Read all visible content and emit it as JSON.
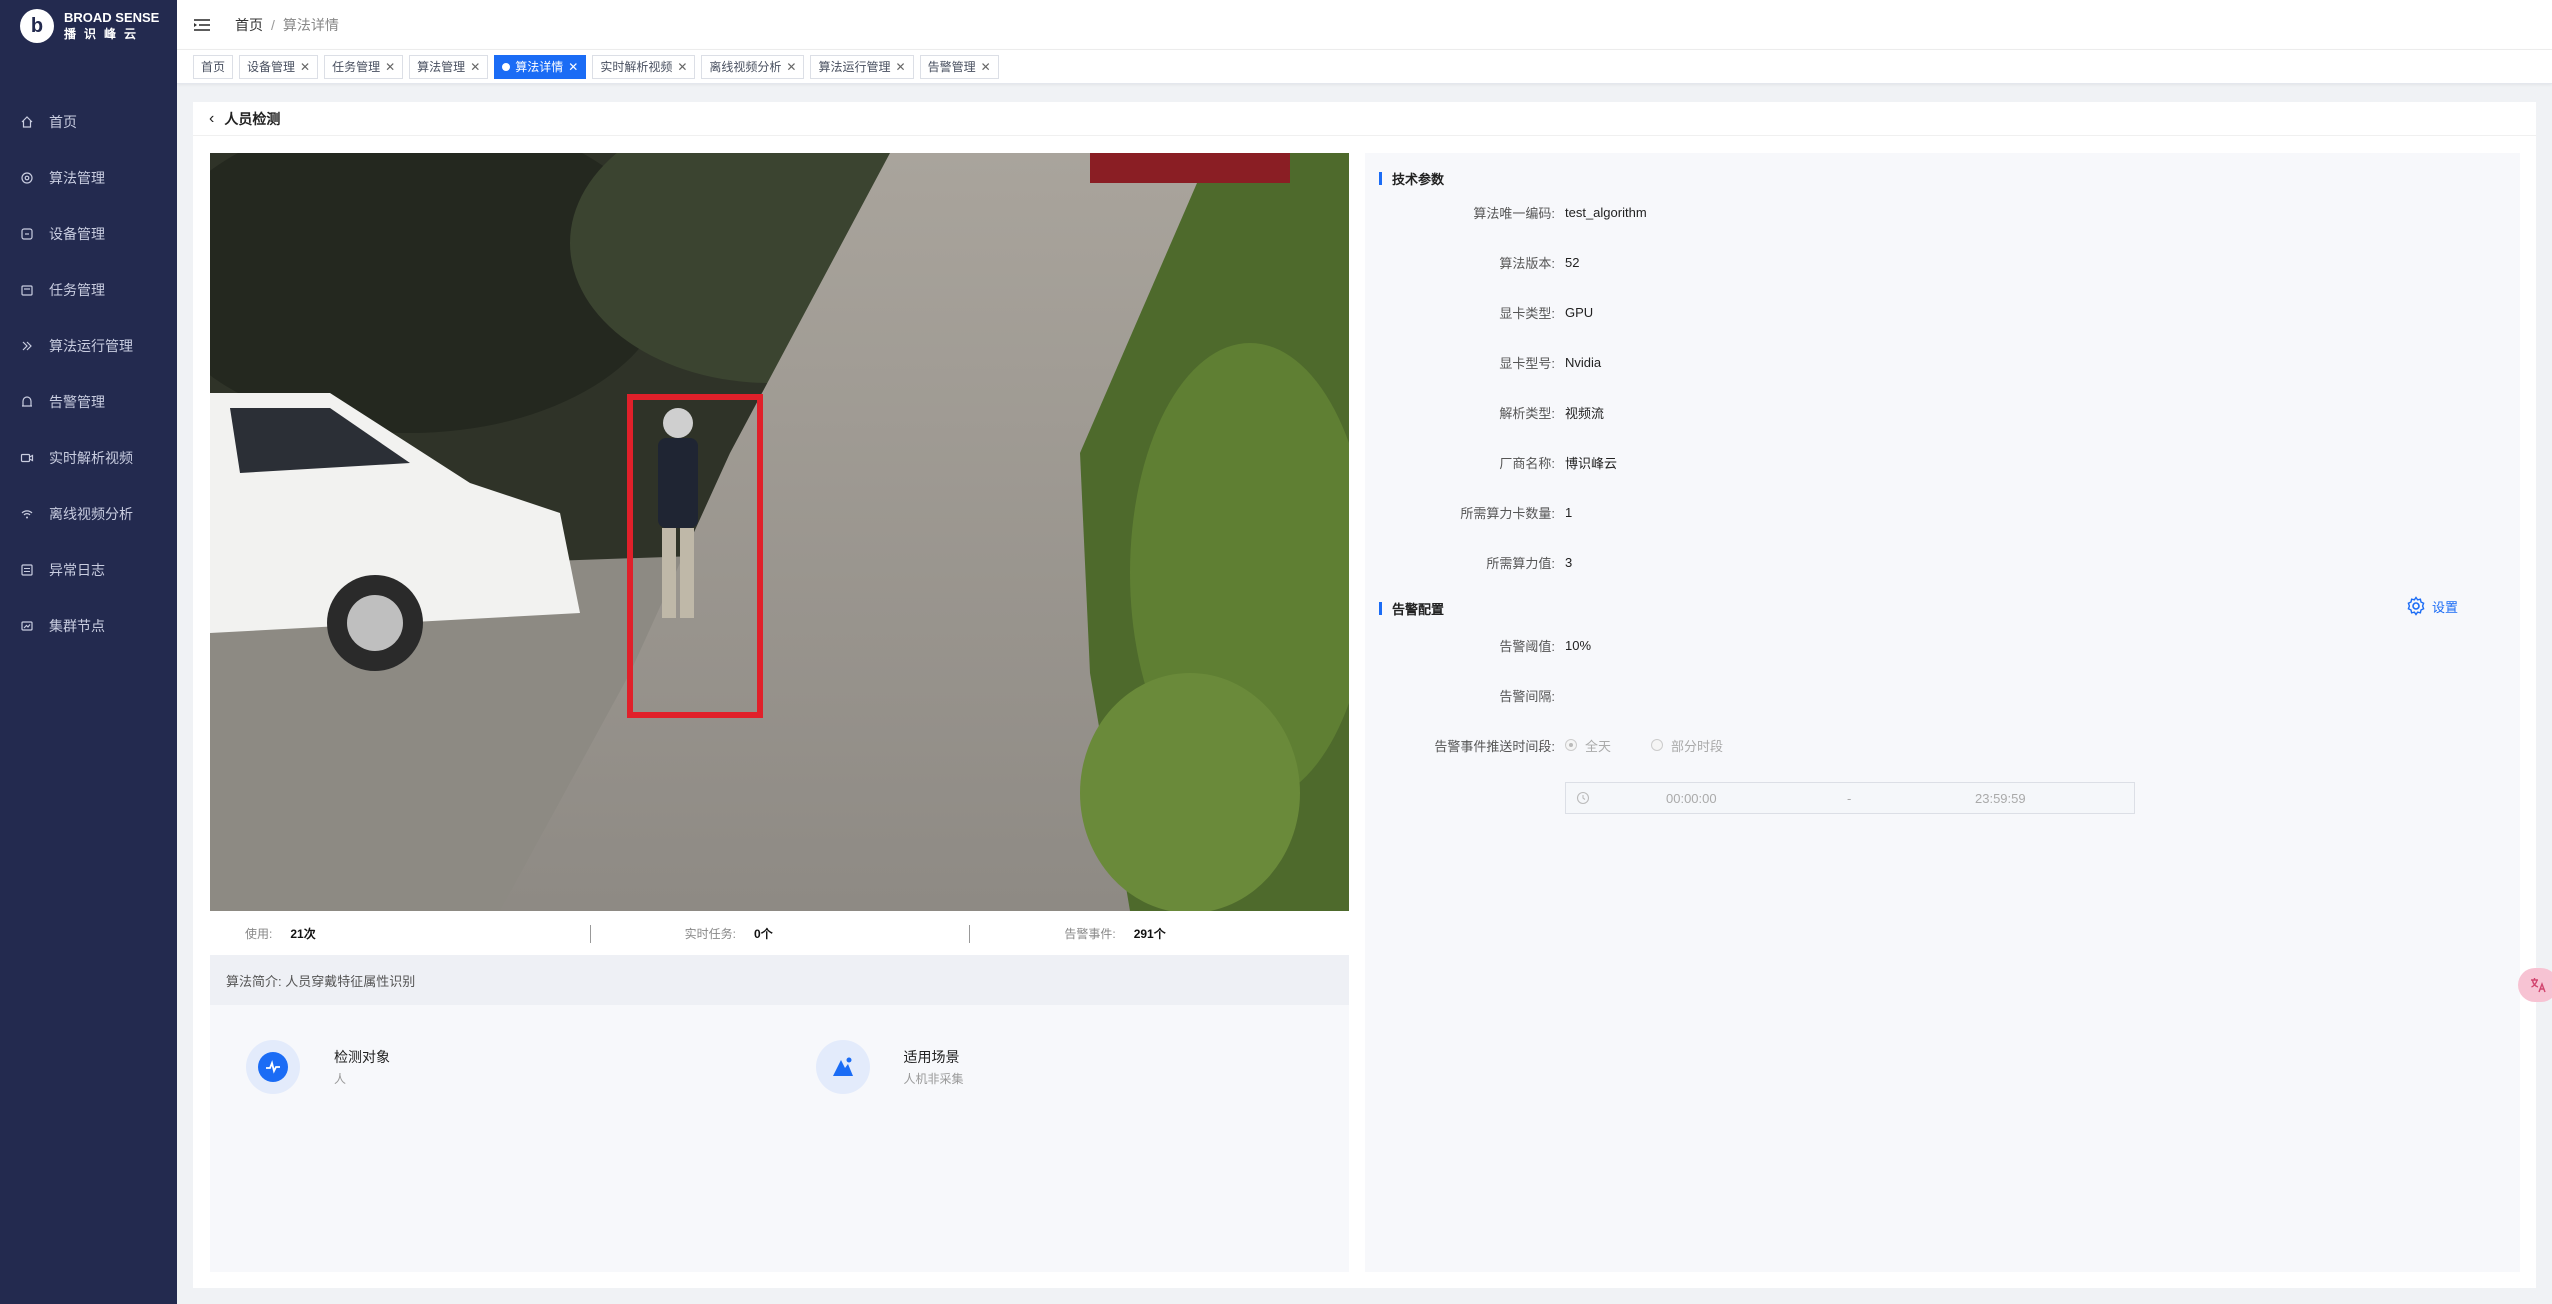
{
  "brand": {
    "logo_letter": "b",
    "name_en": "BROAD SENSE",
    "name_cn": "播识峰云"
  },
  "sidebar": {
    "items": [
      {
        "label": "首页",
        "icon": "home-icon"
      },
      {
        "label": "算法管理",
        "icon": "algorithm-icon"
      },
      {
        "label": "设备管理",
        "icon": "device-icon"
      },
      {
        "label": "任务管理",
        "icon": "task-icon"
      },
      {
        "label": "算法运行管理",
        "icon": "run-icon"
      },
      {
        "label": "告警管理",
        "icon": "alarm-icon"
      },
      {
        "label": "实时解析视频",
        "icon": "video-icon"
      },
      {
        "label": "离线视频分析",
        "icon": "offline-icon"
      },
      {
        "label": "异常日志",
        "icon": "log-icon"
      },
      {
        "label": "集群节点",
        "icon": "cluster-icon"
      }
    ]
  },
  "header": {
    "breadcrumb_home": "首页",
    "breadcrumb_sep": "/",
    "breadcrumb_current": "算法详情"
  },
  "tabs": [
    {
      "label": "首页",
      "closable": false,
      "active": false
    },
    {
      "label": "设备管理",
      "closable": true,
      "active": false
    },
    {
      "label": "任务管理",
      "closable": true,
      "active": false
    },
    {
      "label": "算法管理",
      "closable": true,
      "active": false
    },
    {
      "label": "算法详情",
      "closable": true,
      "active": true
    },
    {
      "label": "实时解析视频",
      "closable": true,
      "active": false
    },
    {
      "label": "离线视频分析",
      "closable": true,
      "active": false
    },
    {
      "label": "算法运行管理",
      "closable": true,
      "active": false
    },
    {
      "label": "告警管理",
      "closable": true,
      "active": false
    }
  ],
  "page": {
    "title": "人员检测"
  },
  "stats": [
    {
      "label": "使用:",
      "value": "21次"
    },
    {
      "label": "实时任务:",
      "value": "0个"
    },
    {
      "label": "告警事件:",
      "value": "291个"
    }
  ],
  "intro": {
    "text": "算法简介: 人员穿戴特征属性识别"
  },
  "features": [
    {
      "title": "检测对象",
      "sub": "人"
    },
    {
      "title": "适用场景",
      "sub": "人机非采集"
    }
  ],
  "tech": {
    "title": "技术参数",
    "rows": [
      {
        "label": "算法唯一编码:",
        "value": "test_algorithm"
      },
      {
        "label": "算法版本:",
        "value": "52"
      },
      {
        "label": "显卡类型:",
        "value": "GPU"
      },
      {
        "label": "显卡型号:",
        "value": "Nvidia"
      },
      {
        "label": "解析类型:",
        "value": "视频流"
      },
      {
        "label": "厂商名称:",
        "value": "博识峰云"
      },
      {
        "label": "所需算力卡数量:",
        "value": "1"
      },
      {
        "label": "所需算力值:",
        "value": "3"
      }
    ]
  },
  "alarm": {
    "title": "告警配置",
    "settings_label": "设置",
    "threshold_label": "告警阈值:",
    "threshold_value": "10%",
    "interval_label": "告警间隔:",
    "interval_value": "",
    "push_label": "告警事件推送时间段:",
    "option_all": "全天",
    "option_partial": "部分时段",
    "selected_option": "全天",
    "time_start": "00:00:00",
    "time_sep": "-",
    "time_end": "23:59:59"
  },
  "colors": {
    "sidebar_bg": "#232a4f",
    "accent": "#1b6cf5",
    "detection_box": "#e0202a"
  },
  "float_button": {
    "icon": "translate-icon"
  }
}
